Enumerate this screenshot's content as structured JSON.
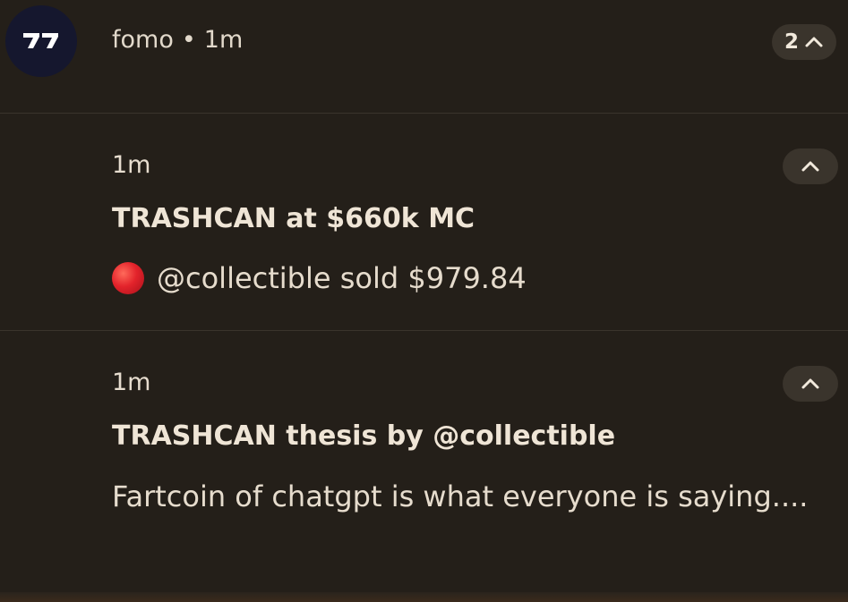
{
  "group": {
    "app_icon": "fomo-logo-icon",
    "app_name": "fomo",
    "separator": "•",
    "time": "1m",
    "count": "2",
    "collapse_icon": "chevron-up-icon"
  },
  "notifications": [
    {
      "time": "1m",
      "title": "TRASHCAN at $660k MC",
      "status_icon": "red-circle-icon",
      "body": "@collectible sold $979.84",
      "expand_icon": "chevron-up-icon"
    },
    {
      "time": "1m",
      "title": "TRASHCAN thesis by @collectible",
      "body": "Fartcoin of chatgpt is what everyone is saying....",
      "expand_icon": "chevron-up-icon"
    }
  ],
  "colors": {
    "background": "#241f19",
    "pill": "#3a342c",
    "icon_bg": "#15172e",
    "red_dot": "#e3232b"
  }
}
